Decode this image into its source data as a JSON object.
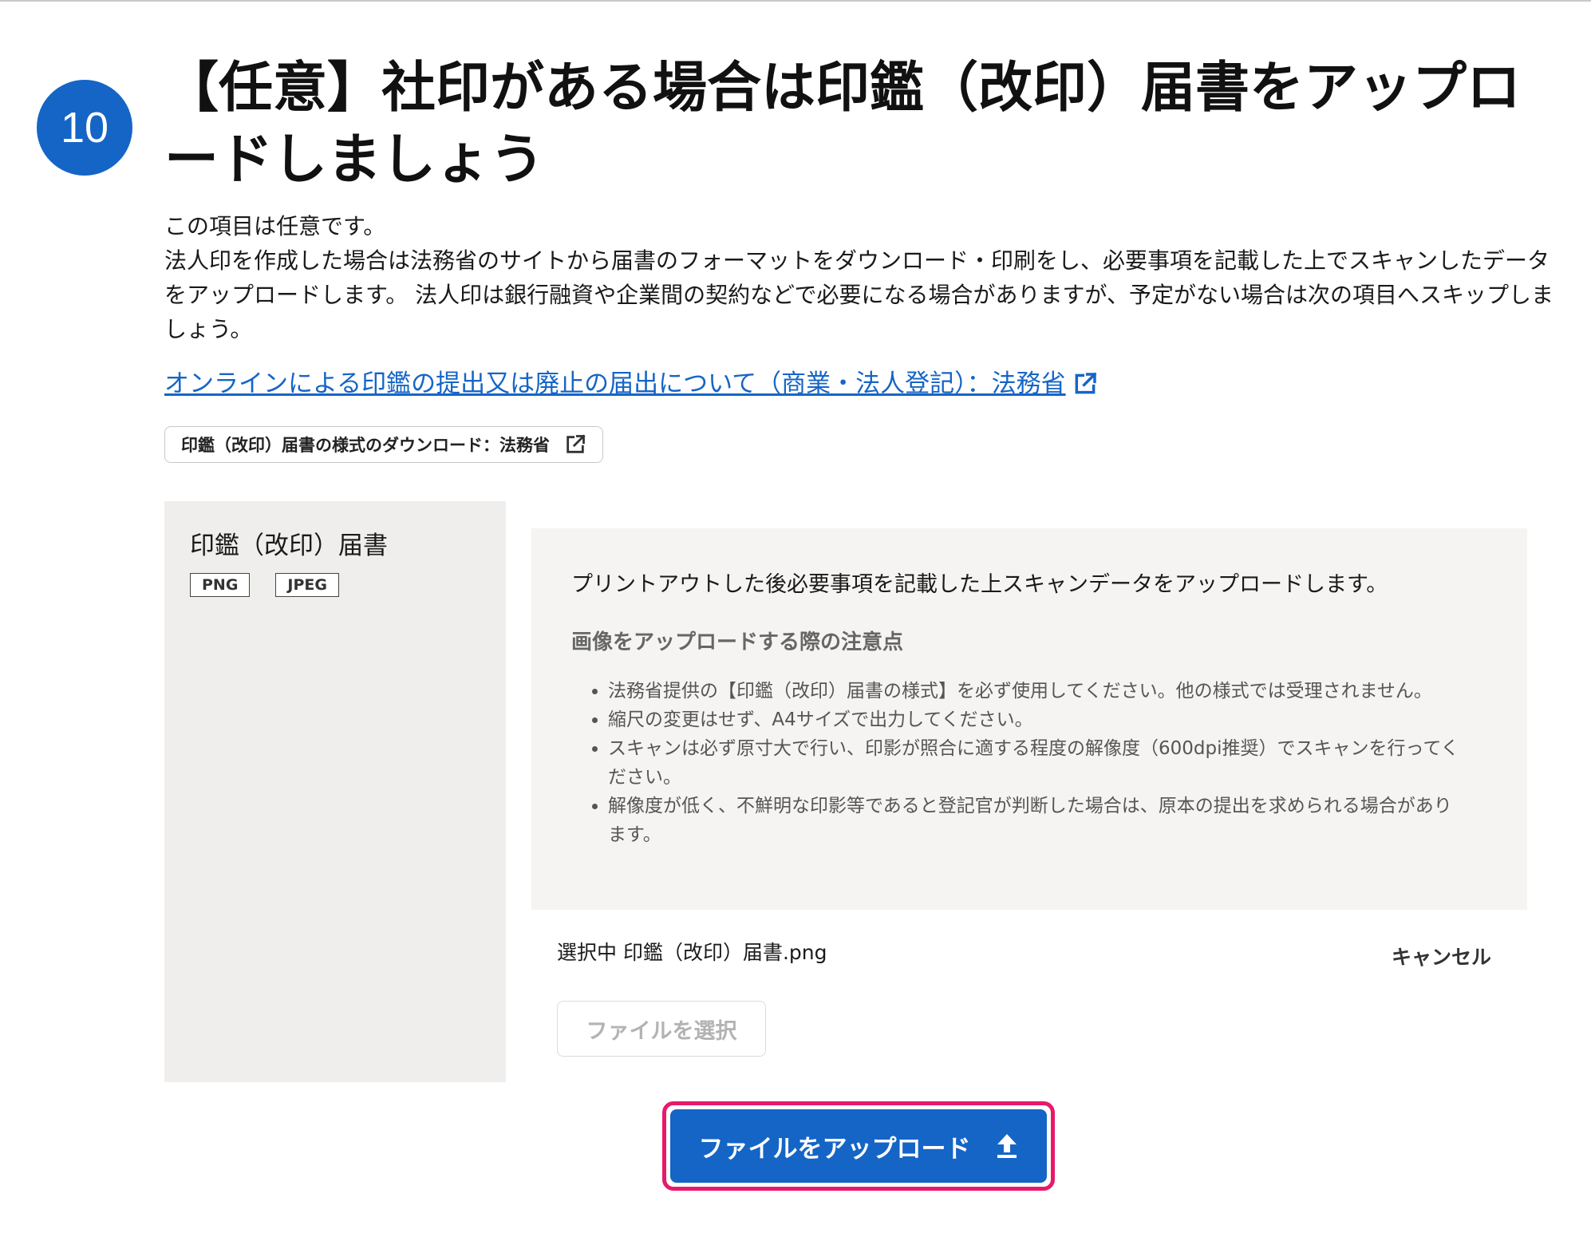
{
  "step": {
    "number": "10",
    "title": "【任意】社印がある場合は印鑑（改印）届書をアップロードしましょう"
  },
  "description": {
    "optional_note": "この項目は任意です。",
    "body": "法人印を作成した場合は法務省のサイトから届書のフォーマットをダウンロード・印刷をし、必要事項を記載した上でスキャンしたデータをアップロードします。 法人印は銀行融資や企業間の契約などで必要になる場合がありますが、予定がない場合は次の項目へスキップしましょう。"
  },
  "links": {
    "moj_online_link": "オンラインによる印鑑の提出又は廃止の届出について（商業・法人登記）：法務省",
    "form_download_button": "印鑑（改印）届書の様式のダウンロード：法務省"
  },
  "document": {
    "title": "印鑑（改印）届書",
    "formats": [
      "PNG",
      "JPEG"
    ]
  },
  "instructions": {
    "lead": "プリントアウトした後必要事項を記載した上スキャンデータをアップロードします。",
    "heading": "画像をアップロードする際の注意点",
    "notes": [
      "法務省提供の【印鑑（改印）届書の様式】を必ず使用してください。他の様式では受理されません。",
      "縮尺の変更はせず、A4サイズで出力してください。",
      "スキャンは必ず原寸大で行い、印影が照合に適する程度の解像度（600dpi推奨）でスキャンを行ってください。",
      "解像度が低く、不鮮明な印影等であると登記官が判断した場合は、原本の提出を求められる場合があります。"
    ]
  },
  "upload": {
    "selected_text": "選択中 印鑑（改印）届書.png",
    "cancel_label": "キャンセル",
    "choose_file_label": "ファイルを選択",
    "upload_label": "ファイルをアップロード"
  },
  "colors": {
    "accent_blue": "#1565c6",
    "highlight_pink": "#e8196a",
    "panel_gray": "#efeeec",
    "info_box_bg": "#f5f4f2"
  },
  "icons": {
    "external_link": "external-link-icon",
    "upload": "upload-icon"
  }
}
